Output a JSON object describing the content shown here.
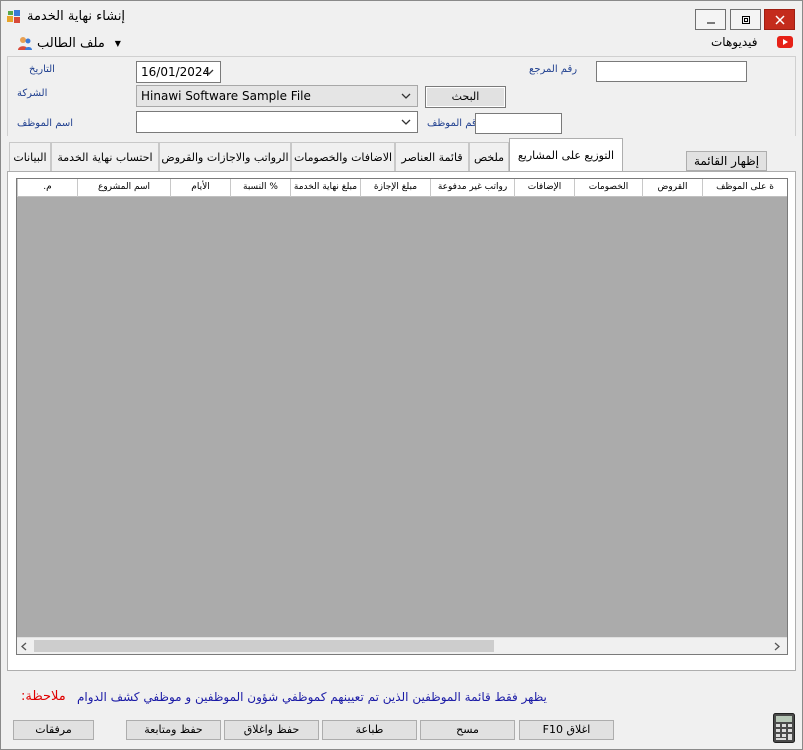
{
  "window": {
    "title": "إنشاء نهاية الخدمة"
  },
  "toolbar": {
    "student_file": "ملف الطالب",
    "videos": "فيديوهات"
  },
  "form": {
    "date_label": "التاريخ",
    "date_value": "16/01/2024",
    "reference_label": "رقم المرجع",
    "reference_value": "",
    "company_label": "الشركة",
    "company_value": "Hinawi Software Sample File",
    "search_button": "البحث",
    "employee_name_label": "اسم الموظف",
    "employee_name_value": "",
    "employee_number_label": "رقم الموظف",
    "employee_number_value": ""
  },
  "tabs": [
    {
      "label": "البيانات"
    },
    {
      "label": "احتساب نهاية الخدمة"
    },
    {
      "label": "الرواتب والاجازات والقروض"
    },
    {
      "label": "الاضافات والخصومات"
    },
    {
      "label": "قائمة العناصر"
    },
    {
      "label": "ملخص"
    },
    {
      "label": "التوزيع على المشاريع"
    }
  ],
  "show_list_button": "إظهار القائمة",
  "grid": {
    "columns": [
      "م.",
      "اسم المشروع",
      "الأيام",
      "% النسبة",
      "مبلغ نهاية الخدمة",
      "مبلغ الإجازة",
      "رواتب غير مدفوعة",
      "الإضافات",
      "الخصومات",
      "القروض",
      "ة على الموظف"
    ]
  },
  "note": {
    "label": "ملاحظة:",
    "text": "يظهر فقط قائمة الموظفين الذين تم تعيينهم كموظفي شؤون الموظفين و موظفي كشف الدوام"
  },
  "buttons": {
    "attachments": "مرفقات",
    "save_follow": "حفظ ومتابعة",
    "save_close": "حفظ واغلاق",
    "print": "طباعة",
    "clear": "مسح",
    "close": "F10 اغلاق"
  },
  "colors": {
    "note_label": "#e00000",
    "note_text": "#1a1aa6",
    "label": "#1f3f8f",
    "close_button": "#c42b1c"
  }
}
